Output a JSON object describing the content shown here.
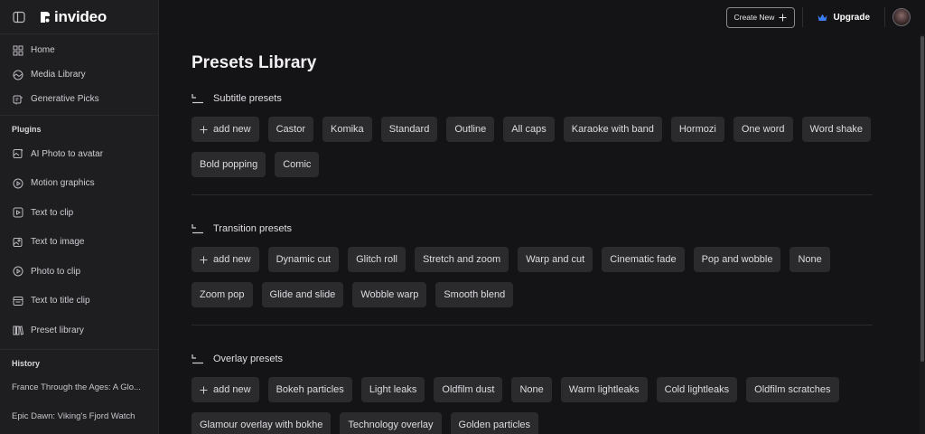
{
  "brand": {
    "name": "invideo"
  },
  "sidebar": {
    "nav": [
      {
        "label": "Home",
        "icon": "home-icon"
      },
      {
        "label": "Media Library",
        "icon": "media-library-icon"
      },
      {
        "label": "Generative Picks",
        "icon": "generative-picks-icon"
      }
    ],
    "plugins_heading": "Plugins",
    "plugins": [
      {
        "label": "AI Photo to avatar",
        "icon": "photo-avatar-icon"
      },
      {
        "label": "Motion graphics",
        "icon": "motion-graphics-icon"
      },
      {
        "label": "Text to clip",
        "icon": "text-to-clip-icon"
      },
      {
        "label": "Text to image",
        "icon": "text-to-image-icon"
      },
      {
        "label": "Photo to clip",
        "icon": "photo-to-clip-icon"
      },
      {
        "label": "Text to title clip",
        "icon": "text-to-title-clip-icon"
      },
      {
        "label": "Preset library",
        "icon": "preset-library-icon"
      }
    ],
    "history_heading": "History",
    "history": [
      "France Through the Ages: A Glo...",
      "Epic Dawn: Viking's Fjord Watch"
    ]
  },
  "header": {
    "create_new": "Create New",
    "upgrade": "Upgrade"
  },
  "main": {
    "title": "Presets Library",
    "groups": [
      {
        "title": "Subtitle presets",
        "add_label": "add new",
        "presets": [
          "Castor",
          "Komika",
          "Standard",
          "Outline",
          "All caps",
          "Karaoke with band",
          "Hormozi",
          "One word",
          "Word shake",
          "Bold popping",
          "Comic"
        ]
      },
      {
        "title": "Transition presets",
        "add_label": "add new",
        "presets": [
          "Dynamic cut",
          "Glitch roll",
          "Stretch and zoom",
          "Warp and cut",
          "Cinematic fade",
          "Pop and wobble",
          "None",
          "Zoom pop",
          "Glide and slide",
          "Wobble warp",
          "Smooth blend"
        ]
      },
      {
        "title": "Overlay presets",
        "add_label": "add new",
        "presets": [
          "Bokeh particles",
          "Light leaks",
          "Oldfilm dust",
          "None",
          "Warm lightleaks",
          "Cold lightleaks",
          "Oldfilm scratches",
          "Glamour overlay with bokhe",
          "Technology overlay",
          "Golden particles"
        ]
      }
    ]
  },
  "colors": {
    "background": "#141315",
    "sidebar": "#1e1d20",
    "chip": "#2b2a2d",
    "upgrade_crown": "#3b7cf0"
  }
}
